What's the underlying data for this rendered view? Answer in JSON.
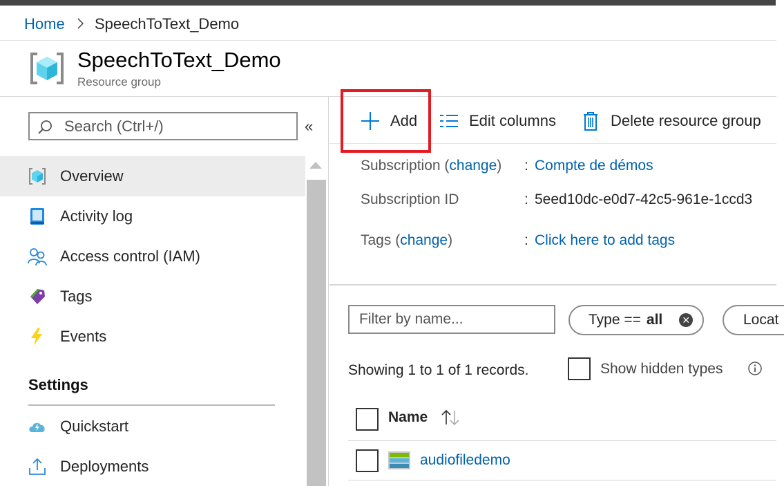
{
  "breadcrumb": {
    "home": "Home",
    "current": "SpeechToText_Demo"
  },
  "header": {
    "title": "SpeechToText_Demo",
    "subtitle": "Resource group"
  },
  "sidebar": {
    "search_placeholder": "Search (Ctrl+/)",
    "collapse_glyph": "«",
    "items": [
      {
        "label": "Overview",
        "icon": "resource-group-icon",
        "active": true
      },
      {
        "label": "Activity log",
        "icon": "activity-log-icon"
      },
      {
        "label": "Access control (IAM)",
        "icon": "access-control-icon"
      },
      {
        "label": "Tags",
        "icon": "tag-icon"
      },
      {
        "label": "Events",
        "icon": "lightning-icon"
      }
    ],
    "settings_heading": "Settings",
    "settings_items": [
      {
        "label": "Quickstart",
        "icon": "cloud-icon"
      },
      {
        "label": "Deployments",
        "icon": "upload-icon"
      }
    ]
  },
  "toolbar": {
    "add_label": "Add",
    "edit_columns_label": "Edit columns",
    "delete_label": "Delete resource group"
  },
  "essentials": {
    "subscription_label_pre": "Subscription (",
    "subscription_change": "change",
    "subscription_label_post": ")",
    "subscription_value": "Compte de démos",
    "subscription_id_label": "Subscription ID",
    "subscription_id_value": "5eed10dc-e0d7-42c5-961e-1ccd3",
    "tags_label_pre": "Tags (",
    "tags_change": "change",
    "tags_label_post": ")",
    "tags_value": "Click here to add tags",
    "colon": ":"
  },
  "filters": {
    "name_placeholder": "Filter by name...",
    "type_pill_prefix": "Type ==",
    "type_pill_value": "all",
    "location_pill": "Locat"
  },
  "records": {
    "showing_text": "Showing 1 to 1 of 1 records.",
    "show_hidden_label": "Show hidden types"
  },
  "table": {
    "name_header": "Name",
    "rows": [
      {
        "name": "audiofiledemo",
        "icon": "storage-account-icon"
      }
    ]
  },
  "colors": {
    "link": "#0062ad",
    "highlight": "#e31b23",
    "active_nav": "#ececec"
  }
}
